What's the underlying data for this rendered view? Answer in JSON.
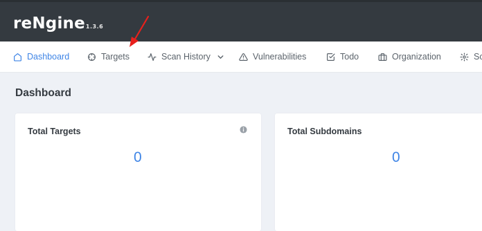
{
  "app": {
    "name": "reNgine",
    "version": "1.3.6"
  },
  "nav": {
    "items": [
      {
        "label": "Dashboard",
        "icon": "home-icon",
        "active": true
      },
      {
        "label": "Targets",
        "icon": "crosshair-icon"
      },
      {
        "label": "Scan History",
        "icon": "activity-icon"
      },
      {
        "label": "Vulnerabilities",
        "icon": "alert-triangle-icon"
      },
      {
        "label": "Todo",
        "icon": "check-square-icon"
      },
      {
        "label": "Organization",
        "icon": "briefcase-icon"
      },
      {
        "label": "Sc",
        "icon": "settings-icon"
      }
    ]
  },
  "page": {
    "title": "Dashboard"
  },
  "cards": [
    {
      "title": "Total Targets",
      "value": "0",
      "has_info": true
    },
    {
      "title": "Total Subdomains",
      "value": "0"
    }
  ],
  "colors": {
    "topbar": "#343a40",
    "accent": "#3f85e6",
    "annotation_arrow": "#e8201c"
  }
}
